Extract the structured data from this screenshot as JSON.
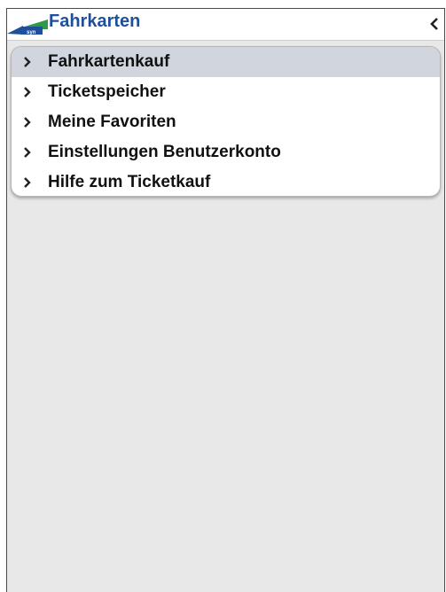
{
  "header": {
    "title": "Fahrkarten",
    "logo_icon": "transit-logo-icon",
    "back_icon": "chevron-left-icon",
    "title_color": "#1f4f9a"
  },
  "menu": {
    "items": [
      {
        "label": "Fahrkartenkauf",
        "icon": "chevron-right-icon",
        "selected": true
      },
      {
        "label": "Ticketspeicher",
        "icon": "chevron-right-icon",
        "selected": false
      },
      {
        "label": "Meine Favoriten",
        "icon": "chevron-right-icon",
        "selected": false
      },
      {
        "label": "Einstellungen Benutzerkonto",
        "icon": "chevron-right-icon",
        "selected": false
      },
      {
        "label": "Hilfe zum Ticketkauf",
        "icon": "chevron-right-icon",
        "selected": false
      }
    ]
  },
  "colors": {
    "background": "#e8e8e8",
    "selected_row": "#d0d5de",
    "logo_green": "#2e9a47",
    "logo_blue": "#1f4f9a"
  }
}
